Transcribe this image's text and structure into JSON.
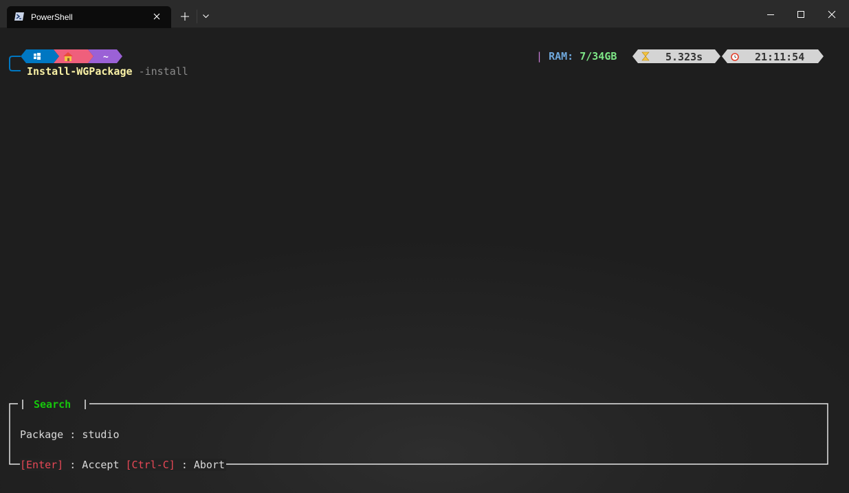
{
  "window": {
    "tab_title": "PowerShell"
  },
  "prompt": {
    "home_segment": "~",
    "command": "Install-WGPackage",
    "argument": "-install",
    "ram_separator": "|",
    "ram_label": "RAM:",
    "ram_value": "7/34GB",
    "exec_time": "5.323s",
    "clock": "21:11:54"
  },
  "search": {
    "title": "Search",
    "package_label": "Package :",
    "package_value": "studio",
    "enter_key": "[Enter]",
    "accept_label": ": Accept",
    "ctrl_c_key": "[Ctrl-C]",
    "abort_label": ": Abort"
  },
  "colors": {
    "os_segment": "#0077c2",
    "home_segment": "#ef5f7c",
    "path_segment": "#9b61d6",
    "info_segment": "#d4d4d4",
    "command": "#f9f1a5",
    "search_title": "#16c60c",
    "keys": "#e74856"
  },
  "icons": [
    "powershell-icon",
    "close-icon",
    "plus-icon",
    "chevron-down-icon",
    "minimize-icon",
    "maximize-icon",
    "windows-icon",
    "house-icon",
    "hourglass-icon",
    "alarm-clock-icon"
  ]
}
